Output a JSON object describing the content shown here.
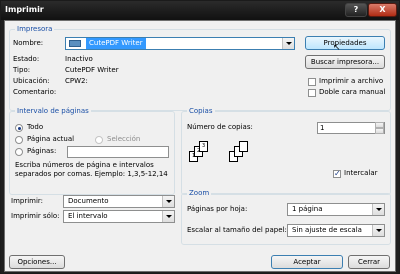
{
  "window": {
    "title": "Imprimir",
    "help_label": "?",
    "close_label": "X"
  },
  "printer": {
    "group_title": "Impresora",
    "name_label": "Nombre:",
    "name_value": "CutePDF Writer",
    "status_label": "Estado:",
    "status_value": "Inactivo",
    "type_label": "Tipo:",
    "type_value": "CutePDF Writer",
    "location_label": "Ubicación:",
    "location_value": "CPW2:",
    "comment_label": "Comentario:",
    "properties_button": "Propiedades",
    "find_printer_button": "Buscar impresora...",
    "print_to_file_label": "Imprimir a archivo",
    "duplex_label": "Doble cara manual",
    "print_to_file_checked": false,
    "duplex_checked": false
  },
  "page_range": {
    "group_title": "Intervalo de páginas",
    "all_label": "Todo",
    "current_page_label": "Página actual",
    "selection_label": "Selección",
    "pages_label": "Páginas:",
    "pages_value": "",
    "selected": "all",
    "hint_line1": "Escriba números de página e intervalos",
    "hint_line2": "separados por comas. Ejemplo: 1,3,5-12,14"
  },
  "copies": {
    "group_title": "Copias",
    "number_label": "Número de copias:",
    "number_value": "1",
    "collate_label": "Intercalar",
    "collate_checked": true,
    "page_marks": [
      "1",
      "2",
      "3"
    ]
  },
  "print_options": {
    "print_label": "Imprimir:",
    "print_value": "Documento",
    "print_only_label": "Imprimir sólo:",
    "print_only_value": "El intervalo"
  },
  "zoom": {
    "group_title": "Zoom",
    "pages_per_sheet_label": "Páginas por hoja:",
    "pages_per_sheet_value": "1 página",
    "scale_label": "Escalar al tamaño del papel:",
    "scale_value": "Sin ajuste de escala"
  },
  "footer": {
    "options_button": "Opciones...",
    "ok_button": "Aceptar",
    "cancel_button": "Cerrar"
  }
}
